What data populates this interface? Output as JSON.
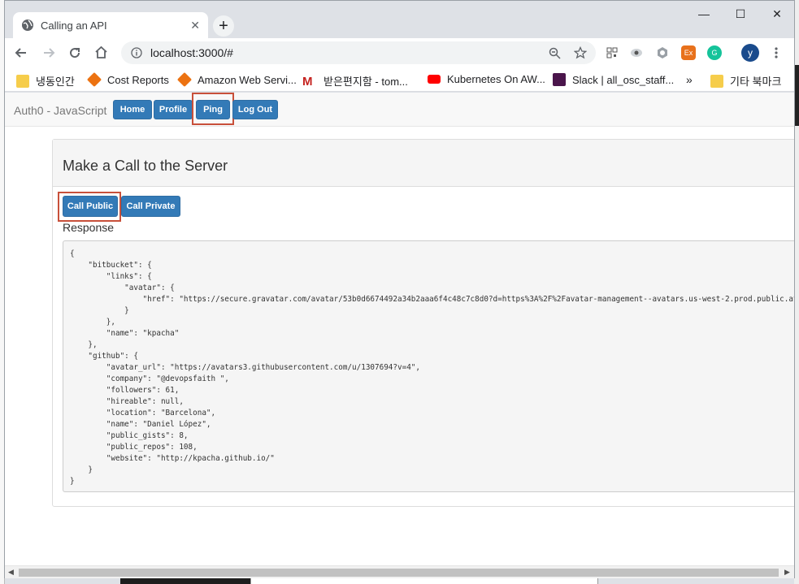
{
  "browser": {
    "tab_title": "Calling an API",
    "tab_close": "✕",
    "new_tab": "+",
    "window_minimize": "—",
    "window_maximize": "☐",
    "window_close": "✕",
    "url": "localhost:3000/#",
    "avatar_letter": "y",
    "bookmarks": [
      {
        "label": "냉동인간",
        "icon": "folder-icon"
      },
      {
        "label": "Cost Reports",
        "icon": "aws-icon"
      },
      {
        "label": "Amazon Web Servi...",
        "icon": "aws-icon"
      },
      {
        "label": "받은편지함 - tom...",
        "icon": "gmail-icon"
      },
      {
        "label": "Kubernetes On AW...",
        "icon": "youtube-icon"
      },
      {
        "label": "Slack | all_osc_staff...",
        "icon": "slack-icon"
      }
    ],
    "bookmarks_overflow": "»",
    "other_bookmarks": "기타 북마크"
  },
  "app": {
    "brand": "Auth0 - JavaScript",
    "nav": {
      "home": "Home",
      "profile": "Profile",
      "ping": "Ping",
      "logout": "Log Out"
    },
    "panel_title": "Make a Call to the Server",
    "call_public": "Call Public",
    "call_private": "Call Private",
    "response_label": "Response",
    "response_body": "{\n    \"bitbucket\": {\n        \"links\": {\n            \"avatar\": {\n                \"href\": \"https://secure.gravatar.com/avatar/53b0d6674492a34b2aaa6f4c48c7c8d0?d=https%3A%2F%2Favatar-management--avatars.us-west-2.prod.public.atl-p\n            }\n        },\n        \"name\": \"kpacha\"\n    },\n    \"github\": {\n        \"avatar_url\": \"https://avatars3.githubusercontent.com/u/1307694?v=4\",\n        \"company\": \"@devopsfaith \",\n        \"followers\": 61,\n        \"hireable\": null,\n        \"location\": \"Barcelona\",\n        \"name\": \"Daniel López\",\n        \"public_gists\": 8,\n        \"public_repos\": 108,\n        \"website\": \"http://kpacha.github.io/\"\n    }\n}"
  },
  "colors": {
    "button_primary": "#337ab7",
    "highlight": "#c8503a"
  }
}
